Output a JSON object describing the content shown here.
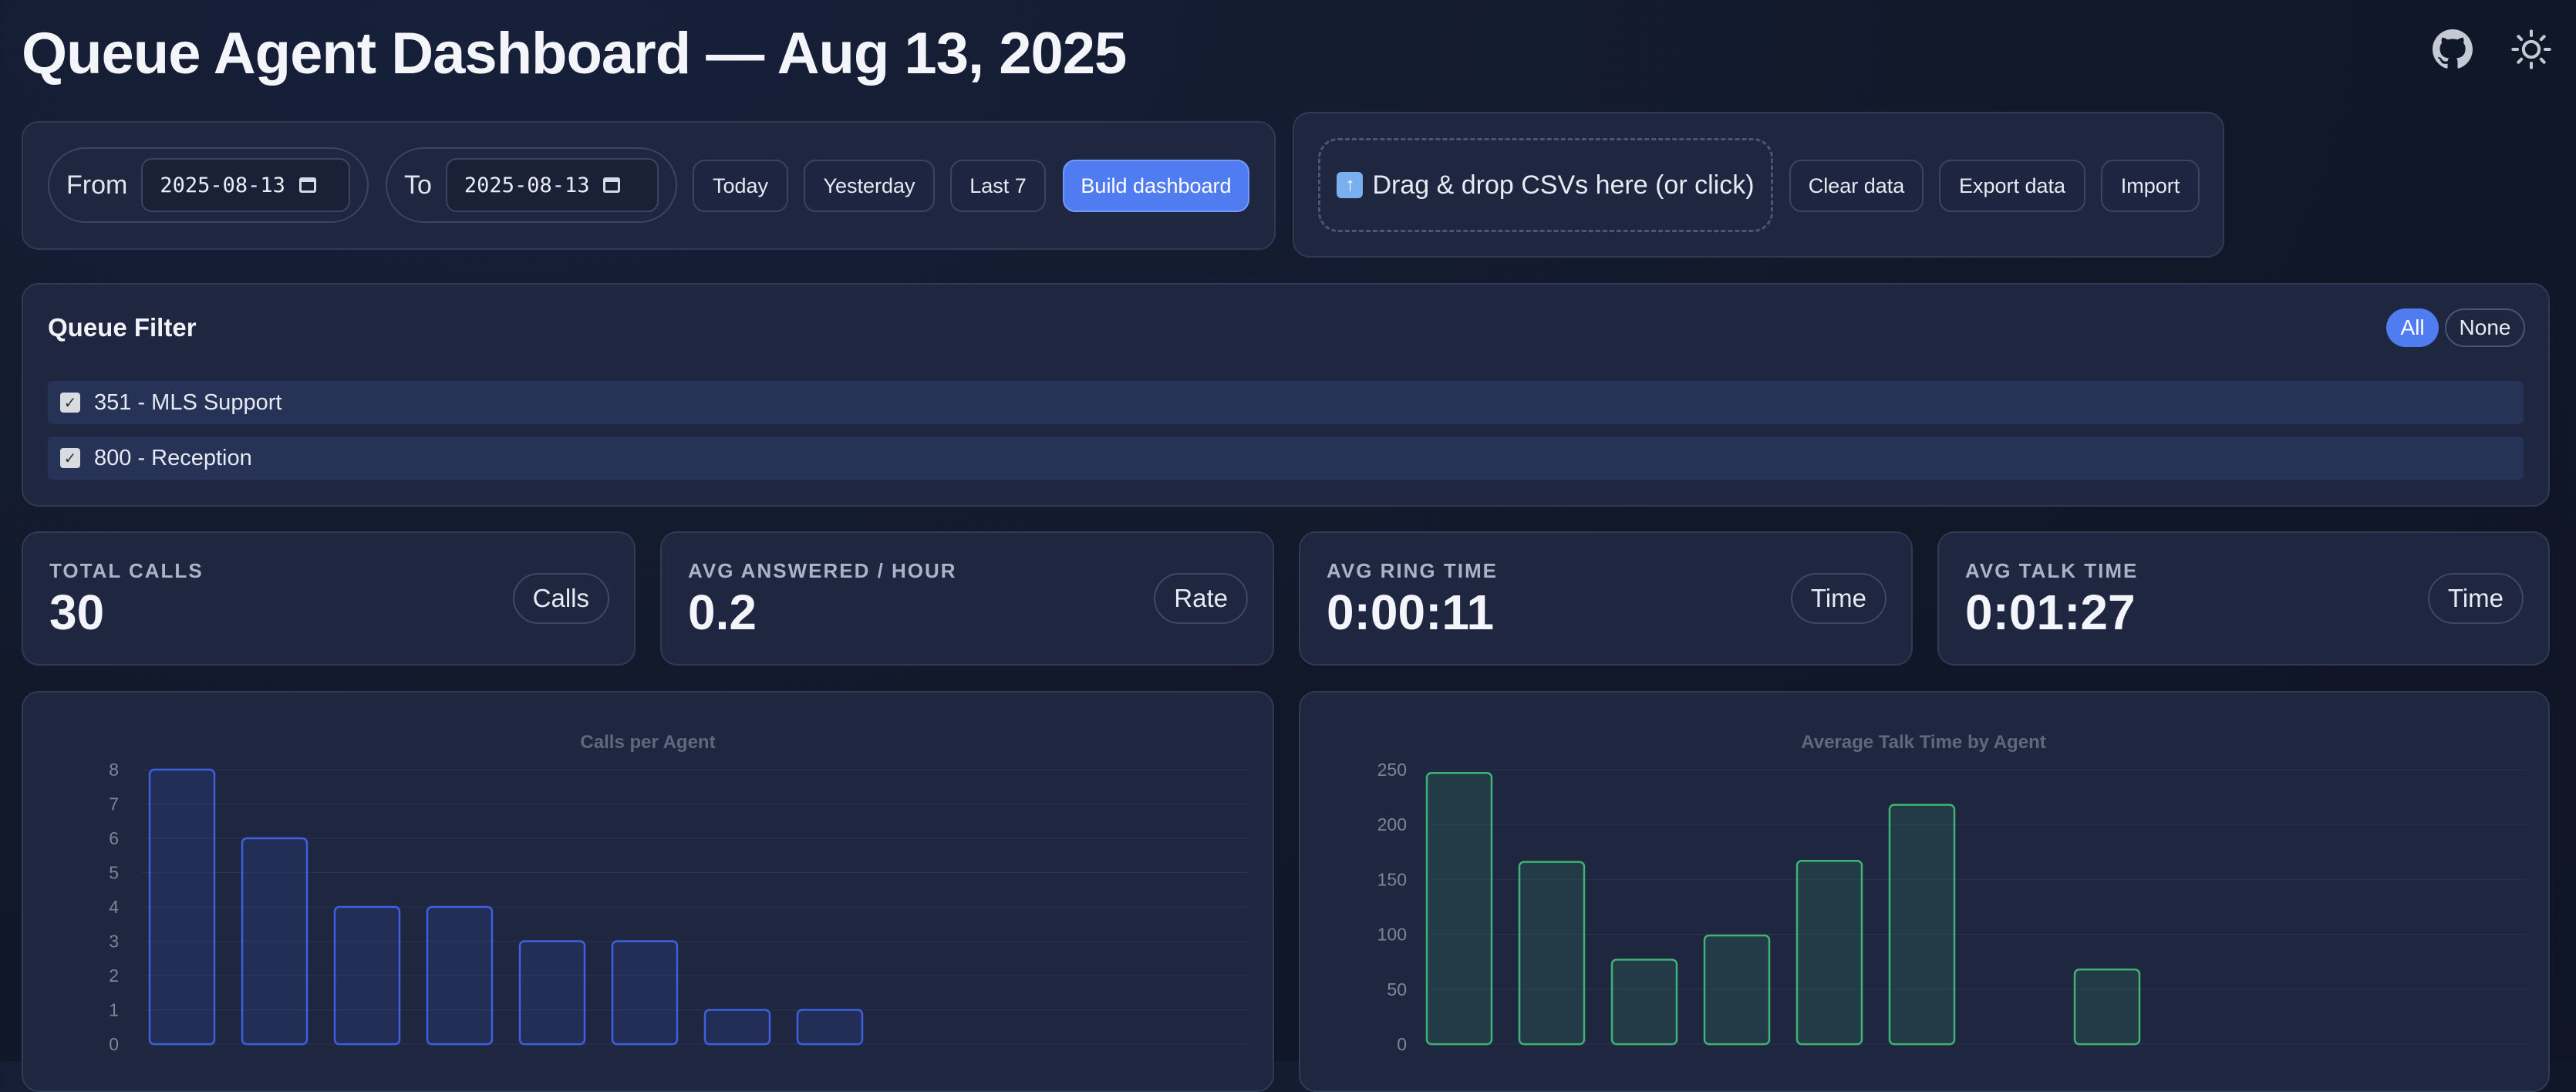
{
  "header": {
    "title": "Queue Agent Dashboard — Aug 13, 2025",
    "github_icon": "github-icon",
    "theme_icon": "sun-icon"
  },
  "date_range": {
    "from_label": "From",
    "from_value": "2025-08-13",
    "to_label": "To",
    "to_value": "2025-08-13",
    "buttons": {
      "today": "Today",
      "yesterday": "Yesterday",
      "last7": "Last 7",
      "build": "Build dashboard"
    }
  },
  "data_panel": {
    "drop_text": "Drag & drop CSVs here (or click)",
    "clear": "Clear data",
    "export": "Export data",
    "import": "Import"
  },
  "queue_filter": {
    "title": "Queue Filter",
    "all": "All",
    "none": "None",
    "queues": [
      {
        "label": "351 - MLS Support",
        "checked": true
      },
      {
        "label": "800 - Reception",
        "checked": true
      }
    ]
  },
  "kpis": [
    {
      "label": "TOTAL CALLS",
      "value": "30",
      "badge": "Calls"
    },
    {
      "label": "AVG ANSWERED / HOUR",
      "value": "0.2",
      "badge": "Rate"
    },
    {
      "label": "AVG RING TIME",
      "value": "0:00:11",
      "badge": "Time"
    },
    {
      "label": "AVG TALK TIME",
      "value": "0:01:27",
      "badge": "Time"
    }
  ],
  "colors": {
    "accent": "#4f7cf0",
    "bar_blue": "#3e5fe0",
    "bar_green": "#3fb374"
  },
  "chart_data": [
    {
      "type": "bar",
      "title": "Calls per Agent",
      "values": [
        8,
        6,
        4,
        4,
        3,
        3,
        1,
        1
      ],
      "yticks": [
        0,
        1,
        2,
        3,
        4,
        5,
        6,
        7,
        8
      ],
      "ylim": [
        0,
        8
      ],
      "grid": true
    },
    {
      "type": "bar",
      "title": "Average Talk Time by Agent",
      "values": [
        247,
        166,
        77,
        99,
        167,
        218,
        0,
        68
      ],
      "yticks": [
        0,
        50,
        100,
        150,
        200,
        250
      ],
      "ylim": [
        0,
        250
      ],
      "grid": true
    }
  ]
}
